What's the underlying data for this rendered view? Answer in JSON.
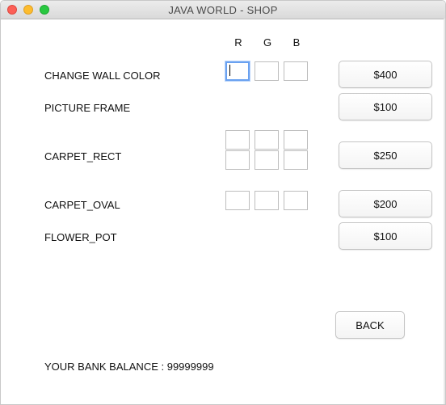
{
  "window": {
    "title": "JAVA WORLD - SHOP"
  },
  "headers": {
    "r": "R",
    "g": "G",
    "b": "B"
  },
  "items": [
    {
      "label": "CHANGE WALL COLOR",
      "price": "$400"
    },
    {
      "label": "PICTURE FRAME",
      "price": "$100"
    },
    {
      "label": "CARPET_RECT",
      "price": "$250"
    },
    {
      "label": "CARPET_OVAL",
      "price": "$200"
    },
    {
      "label": "FLOWER_POT",
      "price": "$100"
    }
  ],
  "back_label": "BACK",
  "balance": {
    "label": "YOUR BANK BALANCE : 99999999"
  },
  "fields": {
    "wall_r": "",
    "wall_g": "",
    "wall_b": "",
    "rect_top_r": "",
    "rect_top_g": "",
    "rect_top_b": "",
    "rect_bot_r": "",
    "rect_bot_g": "",
    "rect_bot_b": "",
    "oval_r": "",
    "oval_g": "",
    "oval_b": ""
  }
}
